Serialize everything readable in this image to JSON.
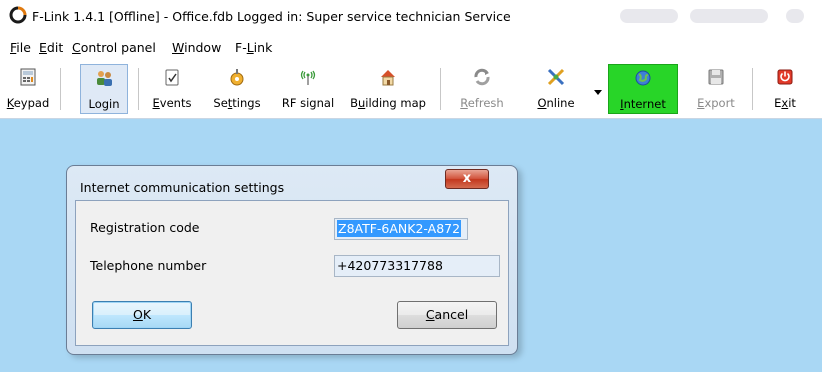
{
  "window": {
    "title": "F-Link 1.4.1 [Offline] - Office.fdb Logged in: Super service technician Service"
  },
  "menu": {
    "items": [
      {
        "key": "F",
        "rest": "ile"
      },
      {
        "key": "E",
        "rest": "dit"
      },
      {
        "key": "C",
        "rest": "ontrol panel"
      },
      {
        "key": "W",
        "rest": "indow"
      },
      {
        "pre": "F-",
        "key": "L",
        "rest": "ink"
      }
    ]
  },
  "toolbar": {
    "keypad": {
      "key": "K",
      "rest": "eypad",
      "icon": "keypad-icon"
    },
    "login": {
      "label": "Login",
      "icon": "login-icon"
    },
    "events": {
      "key": "E",
      "rest": "vents",
      "icon": "events-icon"
    },
    "settings": {
      "pre": "Se",
      "key": "t",
      "rest": "tings",
      "icon": "settings-icon"
    },
    "rf_signal": {
      "label": "RF signal",
      "icon": "rf-signal-icon"
    },
    "building_map": {
      "pre": "B",
      "key": "u",
      "rest": "ilding map",
      "icon": "building-map-icon"
    },
    "refresh": {
      "key": "R",
      "rest": "efresh",
      "icon": "refresh-icon"
    },
    "online": {
      "key": "O",
      "rest": "nline",
      "icon": "online-icon"
    },
    "internet": {
      "key": "I",
      "rest": "nternet",
      "icon": "internet-icon"
    },
    "export": {
      "key": "E",
      "rest": "xport",
      "icon": "export-icon"
    },
    "exit": {
      "pre": "E",
      "key": "x",
      "rest": "it",
      "icon": "exit-icon"
    }
  },
  "dialog": {
    "title": "Internet communication settings",
    "close": "x",
    "registration_code_label": "Registration code",
    "registration_code_value": "Z8ATF-6ANK2-A872",
    "telephone_label": "Telephone number",
    "telephone_value": "+420773317788",
    "ok": {
      "key": "O",
      "rest": "K"
    },
    "cancel": {
      "key": "C",
      "rest": "ancel"
    }
  },
  "colors": {
    "workarea": "#a9d7f4",
    "internet_button": "#28d528",
    "close_button": "#c3381e"
  }
}
